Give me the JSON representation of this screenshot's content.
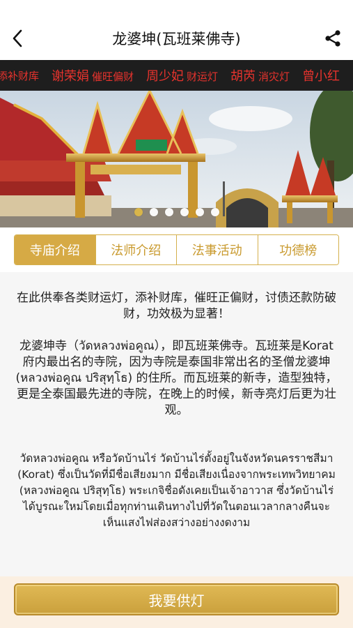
{
  "header": {
    "title": "龙婆坤(瓦班莱佛寺)",
    "back_icon": "back-arrow-icon",
    "share_icon": "share-icon"
  },
  "ticker": {
    "items": [
      {
        "name": "",
        "lamp": "添补财库"
      },
      {
        "name": "谢荣娟",
        "lamp": "催旺偏财"
      },
      {
        "name": "周少妃",
        "lamp": "财运灯"
      },
      {
        "name": "胡芮",
        "lamp": "消灾灯"
      },
      {
        "name": "曾小红",
        "lamp": ""
      }
    ]
  },
  "banner": {
    "dot_count": 6,
    "active_index": 0
  },
  "tabs": [
    {
      "label": "寺庙介绍",
      "active": true
    },
    {
      "label": "法师介绍",
      "active": false
    },
    {
      "label": "法事活动",
      "active": false
    },
    {
      "label": "功德榜",
      "active": false
    }
  ],
  "content": {
    "intro": "在此供奉各类财运灯，添补财库，催旺正偏财，讨债还款防破财，功效极为显著！",
    "description": "龙婆坤寺（วัดหลวงพ่อคูณ），即瓦班莱佛寺。瓦班莱是Korat府内最出名的寺院，因为寺院是泰国非常出名的圣僧龙婆坤 (หลวงพ่อคูณ ปริสุทฺโธ) 的住所。而瓦班莱的新寺，造型独特，更是全泰国最先进的寺院，在晚上的时候，新寺亮灯后更为壮观。",
    "thai": "วัดหลวงพ่อคูณ หรือวัดบ้านไร่  วัดบ้านไร่ตั้งอยู่ในจังหวัดนครราชสีมา  (Korat) ซึ่งเป็นวัดที่มีชื่อเสียงมาก มีชื่อเสียงเนื่องจากพระเทพวิทยาคม (หลวงพ่อคูณ ปริสุทฺโธ) พระเกจิชื่อดังเคยเป็นเจ้าอาวาส ซึ่งวัดบ้านไร่ได้บูรณะใหม่โดยเมื่อทุกท่านเดินทางไปที่วัดในตอนเวลากลางคืนจะเห็นแสงไฟส่องสว่างอย่างงดงาม"
  },
  "footer": {
    "cta_label": "我要供灯"
  },
  "colors": {
    "gold": "#d6aa45",
    "ticker_red": "#e8332d",
    "ticker_bg": "#1e1e1e",
    "footer_bg": "#fbefe1"
  }
}
